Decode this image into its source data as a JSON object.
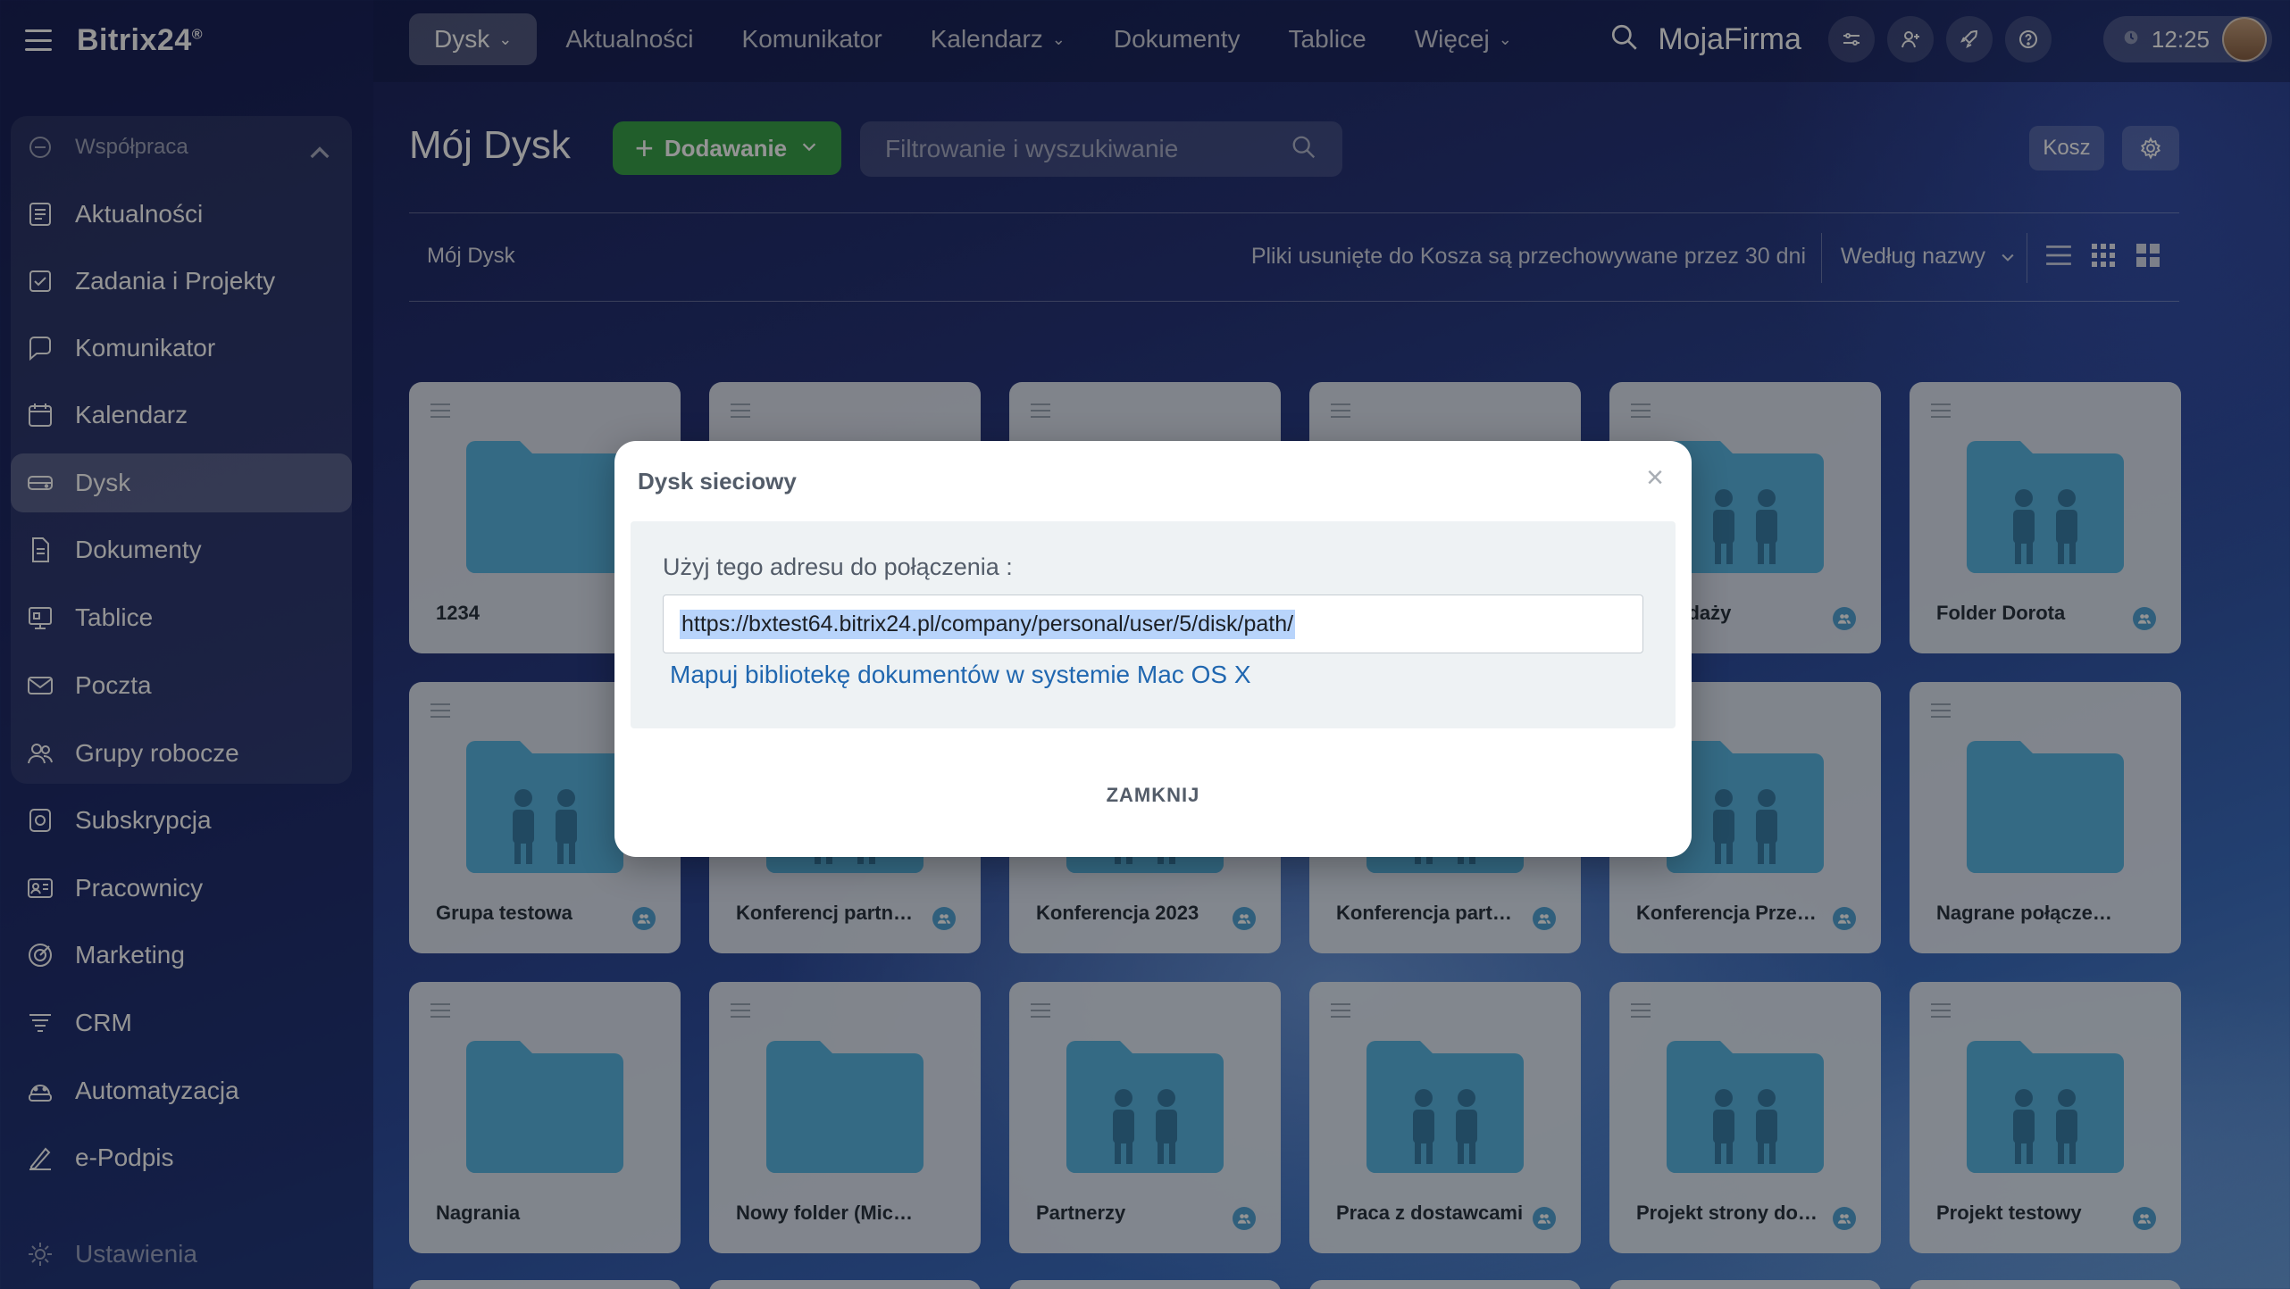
{
  "app": {
    "logo": "Bitrix24",
    "logo_mark": "®"
  },
  "sidebar": {
    "group_label": "Współpraca",
    "items": [
      {
        "label": "Aktualności",
        "icon": "news-icon"
      },
      {
        "label": "Zadania i Projekty",
        "icon": "tasks-icon"
      },
      {
        "label": "Komunikator",
        "icon": "chat-icon"
      },
      {
        "label": "Kalendarz",
        "icon": "calendar-icon"
      },
      {
        "label": "Dysk",
        "icon": "drive-icon",
        "active": true
      },
      {
        "label": "Dokumenty",
        "icon": "document-icon"
      },
      {
        "label": "Tablice",
        "icon": "board-icon"
      },
      {
        "label": "Poczta",
        "icon": "mail-icon"
      },
      {
        "label": "Grupy robocze",
        "icon": "groups-icon"
      },
      {
        "label": "Subskrypcja",
        "icon": "subscription-icon"
      },
      {
        "label": "Pracownicy",
        "icon": "employees-icon"
      },
      {
        "label": "Marketing",
        "icon": "marketing-icon"
      },
      {
        "label": "CRM",
        "icon": "crm-icon"
      },
      {
        "label": "Automatyzacja",
        "icon": "automation-icon"
      },
      {
        "label": "e-Podpis",
        "icon": "signature-icon"
      }
    ],
    "settings_label": "Ustawienia"
  },
  "topnav": {
    "items": [
      "Dysk",
      "Aktualności",
      "Komunikator",
      "Kalendarz",
      "Dokumenty",
      "Tablice",
      "Więcej"
    ],
    "company": "MojaFirma",
    "time": "12:25"
  },
  "page": {
    "title": "Mój Dysk",
    "add_button": "Dodawanie",
    "search_placeholder": "Filtrowanie i wyszukiwanie",
    "trash_button": "Kosz",
    "breadcrumb": "Mój Dysk",
    "trash_note": "Pliki usunięte do Kosza są przechowywane przez 30 dni",
    "sort_label": "Według nazwy"
  },
  "folders": [
    {
      "name": "1234",
      "type": "plain",
      "shared": false
    },
    {
      "name": "",
      "type": "plain",
      "shared": false
    },
    {
      "name": "",
      "type": "plain",
      "shared": false
    },
    {
      "name": "",
      "type": "plain",
      "shared": false
    },
    {
      "name": "sprzedaży",
      "type": "group",
      "shared": true
    },
    {
      "name": "Folder Dorota",
      "type": "group",
      "shared": true
    },
    {
      "name": "Grupa testowa",
      "type": "group",
      "shared": true
    },
    {
      "name": "Konferencj partner...",
      "type": "group",
      "shared": true
    },
    {
      "name": "Konferencja 2023",
      "type": "group",
      "shared": true
    },
    {
      "name": "Konferencja partne...",
      "type": "group",
      "shared": true
    },
    {
      "name": "Konferencja Przed...",
      "type": "group",
      "shared": true
    },
    {
      "name": "Nagrane połączenia w...",
      "type": "plain",
      "shared": false
    },
    {
      "name": "Nagrania",
      "type": "plain",
      "shared": false
    },
    {
      "name": "Nowy folder (Michał R...",
      "type": "plain",
      "shared": false
    },
    {
      "name": "Partnerzy",
      "type": "group",
      "shared": true
    },
    {
      "name": "Praca z dostawcami",
      "type": "group",
      "shared": true
    },
    {
      "name": "Projekt strony doc...",
      "type": "group",
      "shared": true
    },
    {
      "name": "Projekt testowy",
      "type": "group",
      "shared": true
    }
  ],
  "dialog": {
    "title": "Dysk sieciowy",
    "label": "Użyj tego adresu do połączenia :",
    "url": "https://bxtest64.bitrix24.pl/company/personal/user/5/disk/path/",
    "link": "Mapuj bibliotekę dokumentów w systemie Mac OS X",
    "close_button": "ZAMKNIJ"
  },
  "colors": {
    "accent_green": "#39a34b",
    "folder_blue": "#5bb7e4",
    "link_blue": "#2067b0"
  }
}
